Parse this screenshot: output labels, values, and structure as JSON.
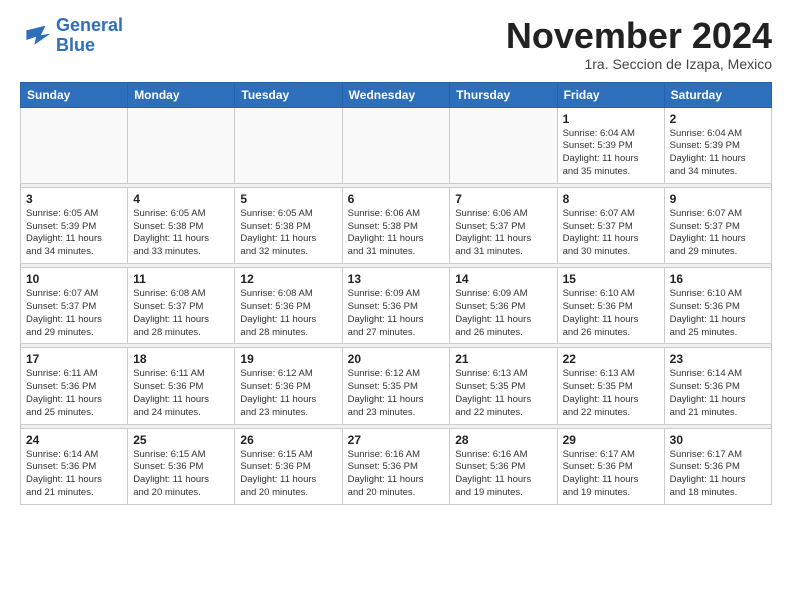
{
  "logo": {
    "line1": "General",
    "line2": "Blue"
  },
  "title": "November 2024",
  "subtitle": "1ra. Seccion de Izapa, Mexico",
  "days_of_week": [
    "Sunday",
    "Monday",
    "Tuesday",
    "Wednesday",
    "Thursday",
    "Friday",
    "Saturday"
  ],
  "weeks": [
    [
      {
        "day": "",
        "detail": ""
      },
      {
        "day": "",
        "detail": ""
      },
      {
        "day": "",
        "detail": ""
      },
      {
        "day": "",
        "detail": ""
      },
      {
        "day": "",
        "detail": ""
      },
      {
        "day": "1",
        "detail": "Sunrise: 6:04 AM\nSunset: 5:39 PM\nDaylight: 11 hours\nand 35 minutes."
      },
      {
        "day": "2",
        "detail": "Sunrise: 6:04 AM\nSunset: 5:39 PM\nDaylight: 11 hours\nand 34 minutes."
      }
    ],
    [
      {
        "day": "3",
        "detail": "Sunrise: 6:05 AM\nSunset: 5:39 PM\nDaylight: 11 hours\nand 34 minutes."
      },
      {
        "day": "4",
        "detail": "Sunrise: 6:05 AM\nSunset: 5:38 PM\nDaylight: 11 hours\nand 33 minutes."
      },
      {
        "day": "5",
        "detail": "Sunrise: 6:05 AM\nSunset: 5:38 PM\nDaylight: 11 hours\nand 32 minutes."
      },
      {
        "day": "6",
        "detail": "Sunrise: 6:06 AM\nSunset: 5:38 PM\nDaylight: 11 hours\nand 31 minutes."
      },
      {
        "day": "7",
        "detail": "Sunrise: 6:06 AM\nSunset: 5:37 PM\nDaylight: 11 hours\nand 31 minutes."
      },
      {
        "day": "8",
        "detail": "Sunrise: 6:07 AM\nSunset: 5:37 PM\nDaylight: 11 hours\nand 30 minutes."
      },
      {
        "day": "9",
        "detail": "Sunrise: 6:07 AM\nSunset: 5:37 PM\nDaylight: 11 hours\nand 29 minutes."
      }
    ],
    [
      {
        "day": "10",
        "detail": "Sunrise: 6:07 AM\nSunset: 5:37 PM\nDaylight: 11 hours\nand 29 minutes."
      },
      {
        "day": "11",
        "detail": "Sunrise: 6:08 AM\nSunset: 5:37 PM\nDaylight: 11 hours\nand 28 minutes."
      },
      {
        "day": "12",
        "detail": "Sunrise: 6:08 AM\nSunset: 5:36 PM\nDaylight: 11 hours\nand 28 minutes."
      },
      {
        "day": "13",
        "detail": "Sunrise: 6:09 AM\nSunset: 5:36 PM\nDaylight: 11 hours\nand 27 minutes."
      },
      {
        "day": "14",
        "detail": "Sunrise: 6:09 AM\nSunset: 5:36 PM\nDaylight: 11 hours\nand 26 minutes."
      },
      {
        "day": "15",
        "detail": "Sunrise: 6:10 AM\nSunset: 5:36 PM\nDaylight: 11 hours\nand 26 minutes."
      },
      {
        "day": "16",
        "detail": "Sunrise: 6:10 AM\nSunset: 5:36 PM\nDaylight: 11 hours\nand 25 minutes."
      }
    ],
    [
      {
        "day": "17",
        "detail": "Sunrise: 6:11 AM\nSunset: 5:36 PM\nDaylight: 11 hours\nand 25 minutes."
      },
      {
        "day": "18",
        "detail": "Sunrise: 6:11 AM\nSunset: 5:36 PM\nDaylight: 11 hours\nand 24 minutes."
      },
      {
        "day": "19",
        "detail": "Sunrise: 6:12 AM\nSunset: 5:36 PM\nDaylight: 11 hours\nand 23 minutes."
      },
      {
        "day": "20",
        "detail": "Sunrise: 6:12 AM\nSunset: 5:35 PM\nDaylight: 11 hours\nand 23 minutes."
      },
      {
        "day": "21",
        "detail": "Sunrise: 6:13 AM\nSunset: 5:35 PM\nDaylight: 11 hours\nand 22 minutes."
      },
      {
        "day": "22",
        "detail": "Sunrise: 6:13 AM\nSunset: 5:35 PM\nDaylight: 11 hours\nand 22 minutes."
      },
      {
        "day": "23",
        "detail": "Sunrise: 6:14 AM\nSunset: 5:36 PM\nDaylight: 11 hours\nand 21 minutes."
      }
    ],
    [
      {
        "day": "24",
        "detail": "Sunrise: 6:14 AM\nSunset: 5:36 PM\nDaylight: 11 hours\nand 21 minutes."
      },
      {
        "day": "25",
        "detail": "Sunrise: 6:15 AM\nSunset: 5:36 PM\nDaylight: 11 hours\nand 20 minutes."
      },
      {
        "day": "26",
        "detail": "Sunrise: 6:15 AM\nSunset: 5:36 PM\nDaylight: 11 hours\nand 20 minutes."
      },
      {
        "day": "27",
        "detail": "Sunrise: 6:16 AM\nSunset: 5:36 PM\nDaylight: 11 hours\nand 20 minutes."
      },
      {
        "day": "28",
        "detail": "Sunrise: 6:16 AM\nSunset: 5:36 PM\nDaylight: 11 hours\nand 19 minutes."
      },
      {
        "day": "29",
        "detail": "Sunrise: 6:17 AM\nSunset: 5:36 PM\nDaylight: 11 hours\nand 19 minutes."
      },
      {
        "day": "30",
        "detail": "Sunrise: 6:17 AM\nSunset: 5:36 PM\nDaylight: 11 hours\nand 18 minutes."
      }
    ]
  ]
}
